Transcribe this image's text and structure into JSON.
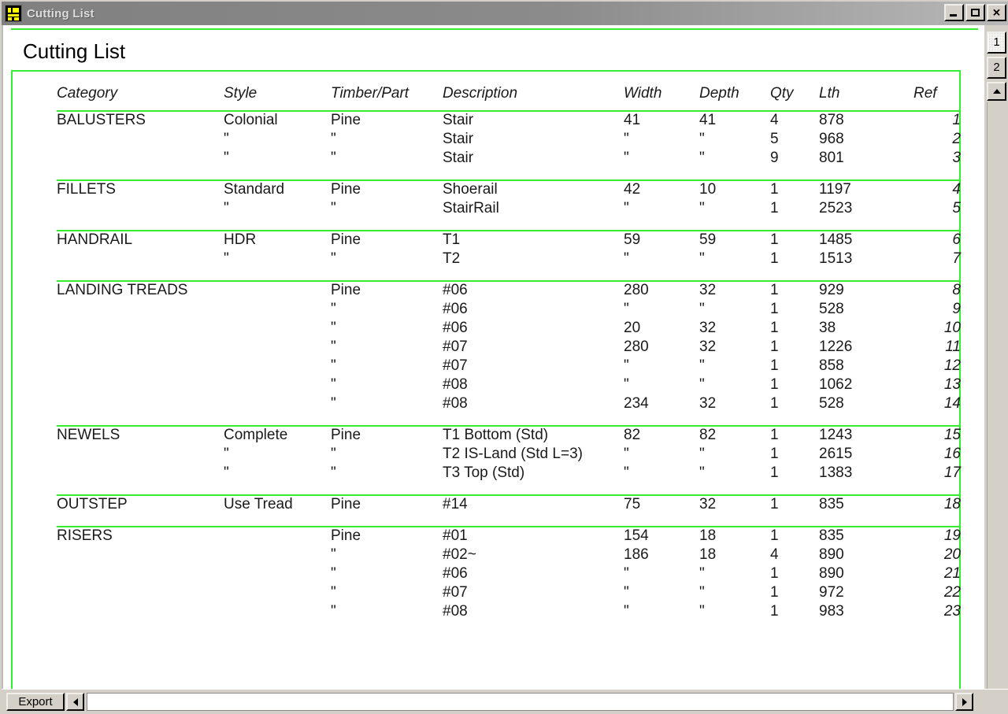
{
  "window": {
    "title": "Cutting List",
    "icon": "app-grid-icon",
    "buttons": {
      "minimize": "minimize",
      "maximize": "maximize",
      "close": "✕"
    }
  },
  "report": {
    "heading": "Cutting List",
    "accent_color": "#33ee33",
    "columns": [
      "Category",
      "Style",
      "Timber/Part",
      "Description",
      "Width",
      "Depth",
      "Qty",
      "Lth",
      "Ref"
    ],
    "ditto": "\"",
    "groups": [
      {
        "category": "BALUSTERS",
        "rows": [
          {
            "style": "Colonial",
            "timber": "Pine",
            "description": "Stair",
            "width": "41",
            "depth": "41",
            "qty": "4",
            "lth": "878",
            "ref": "1"
          },
          {
            "style": "\"",
            "timber": "\"",
            "description": "Stair",
            "width": "\"",
            "depth": "\"",
            "qty": "5",
            "lth": "968",
            "ref": "2"
          },
          {
            "style": "\"",
            "timber": "\"",
            "description": "Stair",
            "width": "\"",
            "depth": "\"",
            "qty": "9",
            "lth": "801",
            "ref": "3"
          }
        ]
      },
      {
        "category": "FILLETS",
        "rows": [
          {
            "style": "Standard",
            "timber": "Pine",
            "description": "Shoerail",
            "width": "42",
            "depth": "10",
            "qty": "1",
            "lth": "1197",
            "ref": "4"
          },
          {
            "style": "\"",
            "timber": "\"",
            "description": "StairRail",
            "width": "\"",
            "depth": "\"",
            "qty": "1",
            "lth": "2523",
            "ref": "5"
          }
        ]
      },
      {
        "category": "HANDRAIL",
        "rows": [
          {
            "style": "HDR",
            "timber": "Pine",
            "description": "T1",
            "width": "59",
            "depth": "59",
            "qty": "1",
            "lth": "1485",
            "ref": "6"
          },
          {
            "style": "\"",
            "timber": "\"",
            "description": "T2",
            "width": "\"",
            "depth": "\"",
            "qty": "1",
            "lth": "1513",
            "ref": "7"
          }
        ]
      },
      {
        "category": "LANDING TREADS",
        "rows": [
          {
            "style": "",
            "timber": "Pine",
            "description": "#06",
            "width": "280",
            "depth": "32",
            "qty": "1",
            "lth": "929",
            "ref": "8"
          },
          {
            "style": "",
            "timber": "\"",
            "description": "#06",
            "width": "\"",
            "depth": "\"",
            "qty": "1",
            "lth": "528",
            "ref": "9"
          },
          {
            "style": "",
            "timber": "\"",
            "description": "#06",
            "width": "20",
            "depth": "32",
            "qty": "1",
            "lth": "38",
            "ref": "10"
          },
          {
            "style": "",
            "timber": "\"",
            "description": "#07",
            "width": "280",
            "depth": "32",
            "qty": "1",
            "lth": "1226",
            "ref": "11"
          },
          {
            "style": "",
            "timber": "\"",
            "description": "#07",
            "width": "\"",
            "depth": "\"",
            "qty": "1",
            "lth": "858",
            "ref": "12"
          },
          {
            "style": "",
            "timber": "\"",
            "description": "#08",
            "width": "\"",
            "depth": "\"",
            "qty": "1",
            "lth": "1062",
            "ref": "13"
          },
          {
            "style": "",
            "timber": "\"",
            "description": "#08",
            "width": "234",
            "depth": "32",
            "qty": "1",
            "lth": "528",
            "ref": "14"
          }
        ]
      },
      {
        "category": "NEWELS",
        "rows": [
          {
            "style": "Complete",
            "timber": "Pine",
            "description": "T1 Bottom (Std)",
            "width": "82",
            "depth": "82",
            "qty": "1",
            "lth": "1243",
            "ref": "15"
          },
          {
            "style": "\"",
            "timber": "\"",
            "description": "T2 IS-Land (Std L=3)",
            "width": "\"",
            "depth": "\"",
            "qty": "1",
            "lth": "2615",
            "ref": "16"
          },
          {
            "style": "\"",
            "timber": "\"",
            "description": "T3 Top (Std)",
            "width": "\"",
            "depth": "\"",
            "qty": "1",
            "lth": "1383",
            "ref": "17"
          }
        ]
      },
      {
        "category": "OUTSTEP",
        "rows": [
          {
            "style": "Use Tread",
            "timber": "Pine",
            "description": "#14",
            "width": "75",
            "depth": "32",
            "qty": "1",
            "lth": "835",
            "ref": "18"
          }
        ]
      },
      {
        "category": "RISERS",
        "rows": [
          {
            "style": "",
            "timber": "Pine",
            "description": "#01",
            "width": "154",
            "depth": "18",
            "qty": "1",
            "lth": "835",
            "ref": "19"
          },
          {
            "style": "",
            "timber": "\"",
            "description": "#02~",
            "width": "186",
            "depth": "18",
            "qty": "4",
            "lth": "890",
            "ref": "20"
          },
          {
            "style": "",
            "timber": "\"",
            "description": "#06",
            "width": "\"",
            "depth": "\"",
            "qty": "1",
            "lth": "890",
            "ref": "21"
          },
          {
            "style": "",
            "timber": "\"",
            "description": "#07",
            "width": "\"",
            "depth": "\"",
            "qty": "1",
            "lth": "972",
            "ref": "22"
          },
          {
            "style": "",
            "timber": "\"",
            "description": "#08",
            "width": "\"",
            "depth": "\"",
            "qty": "1",
            "lth": "983",
            "ref": "23"
          }
        ]
      }
    ]
  },
  "page_tabs": [
    {
      "label": "1",
      "selected": true
    },
    {
      "label": "2",
      "selected": false
    }
  ],
  "bottom_bar": {
    "export_label": "Export",
    "scroll_left": "left-arrow",
    "scroll_right": "right-arrow"
  }
}
